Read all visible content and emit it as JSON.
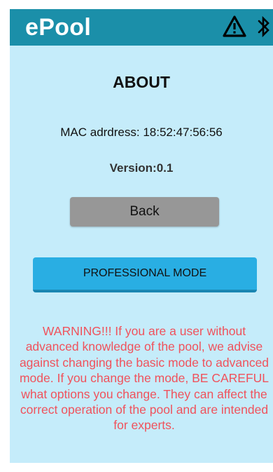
{
  "app": {
    "title": "ePool"
  },
  "icons": {
    "warning": "warning-icon",
    "bluetooth": "bluetooth-icon"
  },
  "about": {
    "title": "ABOUT",
    "mac_line": "MAC adrdress: 18:52:47:56:56",
    "version_line": "Version:0.1",
    "back_label": "Back",
    "professional_mode_label": "PROFESSIONAL MODE",
    "warning_text": "WARNING!!!  If you are a user without advanced knowledge of the pool, we advise against changing the basic mode to advanced mode. If you change the mode, BE CAREFUL what options you change. They can affect the correct operation of the pool and are intended for experts."
  },
  "colors": {
    "topbar": "#1b8fa9",
    "background": "#c5ecfa",
    "back_button": "#979797",
    "professional_button": "#29aee3",
    "warning_text": "#f0525c"
  }
}
